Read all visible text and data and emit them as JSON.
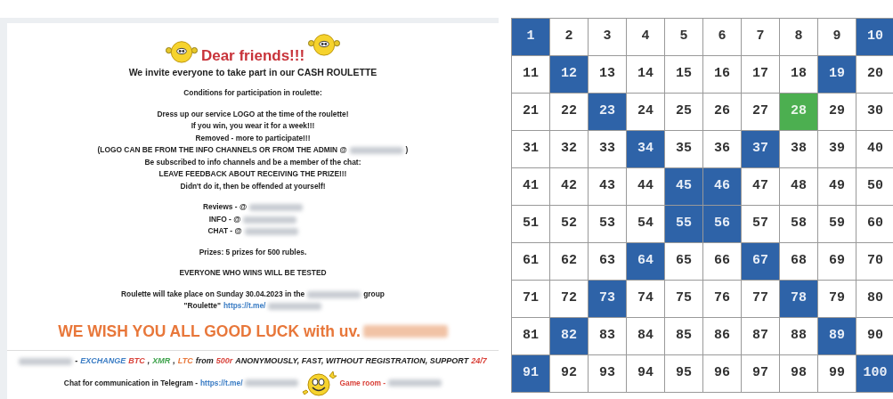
{
  "notice": {
    "title": "Dear friends!!!",
    "blocks": [
      [
        {
          "kind": "heading",
          "segments": [
            {
              "kind": "text",
              "text": "We invite everyone to take part in our CASH ROULETTE"
            }
          ]
        }
      ],
      [
        {
          "kind": "line",
          "segments": [
            {
              "kind": "text",
              "text": "Conditions for participation in roulette:"
            }
          ]
        }
      ],
      [
        {
          "kind": "line",
          "segments": [
            {
              "kind": "text",
              "text": "Dress up our service LOGO at the time of the roulette!"
            }
          ]
        },
        {
          "kind": "line",
          "segments": [
            {
              "kind": "text",
              "text": "If you win, you wear it for a week!!!"
            }
          ]
        },
        {
          "kind": "line",
          "segments": [
            {
              "kind": "text",
              "text": "Removed - more to participate!!!"
            }
          ]
        },
        {
          "kind": "line",
          "segments": [
            {
              "kind": "text",
              "text": "(LOGO CAN BE FROM THE INFO CHANNELS OR FROM THE ADMIN @"
            },
            {
              "kind": "redacted"
            },
            {
              "kind": "text",
              "text": ")"
            }
          ]
        },
        {
          "kind": "line",
          "segments": [
            {
              "kind": "text",
              "text": "Be subscribed to info channels and be a member of the chat:"
            }
          ]
        },
        {
          "kind": "line",
          "segments": [
            {
              "kind": "text",
              "text": "LEAVE FEEDBACK ABOUT RECEIVING THE PRIZE!!!"
            }
          ]
        },
        {
          "kind": "line",
          "segments": [
            {
              "kind": "text",
              "text": "Didn't do it, then be offended at yourself!"
            }
          ]
        }
      ],
      [
        {
          "kind": "line",
          "segments": [
            {
              "kind": "text",
              "text": "Reviews - @"
            },
            {
              "kind": "redacted"
            }
          ]
        },
        {
          "kind": "line",
          "segments": [
            {
              "kind": "text",
              "text": "INFO - @"
            },
            {
              "kind": "redacted"
            }
          ]
        },
        {
          "kind": "line",
          "segments": [
            {
              "kind": "text",
              "text": "CHAT - @"
            },
            {
              "kind": "redacted"
            }
          ]
        }
      ],
      [
        {
          "kind": "line",
          "segments": [
            {
              "kind": "text",
              "text": "Prizes: 5 prizes for 500 rubles."
            }
          ]
        }
      ],
      [
        {
          "kind": "line",
          "segments": [
            {
              "kind": "text",
              "text": "EVERYONE WHO WINS WILL BE TESTED"
            }
          ]
        }
      ],
      [
        {
          "kind": "line",
          "segments": [
            {
              "kind": "text",
              "text": "Roulette will take place on Sunday 30.04.2023 in the"
            },
            {
              "kind": "redacted"
            },
            {
              "kind": "text",
              "text": "group"
            }
          ]
        },
        {
          "kind": "line",
          "segments": [
            {
              "kind": "text",
              "text": "\"Roulette\""
            },
            {
              "kind": "link",
              "text": "https://t.me/"
            },
            {
              "kind": "redacted"
            }
          ]
        }
      ],
      [
        {
          "kind": "wish",
          "segments": [
            {
              "kind": "text",
              "text": "WE WISH YOU ALL GOOD LUCK with uv."
            },
            {
              "kind": "redacted"
            }
          ]
        }
      ]
    ],
    "exchange": [
      {
        "kind": "redacted"
      },
      {
        "kind": "text",
        "text": "-"
      },
      {
        "kind": "text",
        "text": "EXCHANGE",
        "color": "#3a7cc4"
      },
      {
        "kind": "text",
        "text": "BTC",
        "color": "#d9423a"
      },
      {
        "kind": "text",
        "text": ","
      },
      {
        "kind": "text",
        "text": "XMR",
        "color": "#3fa34d"
      },
      {
        "kind": "text",
        "text": ","
      },
      {
        "kind": "text",
        "text": "LTC",
        "color": "#e8773a"
      },
      {
        "kind": "text",
        "text": "from",
        "color": "#222222"
      },
      {
        "kind": "text",
        "text": "500r",
        "color": "#d9423a"
      },
      {
        "kind": "text",
        "text": "ANONYMOUSLY, FAST, WITHOUT REGISTRATION, SUPPORT",
        "color": "#222222"
      },
      {
        "kind": "text",
        "text": "24/7",
        "color": "#d9423a"
      }
    ],
    "footer": [
      {
        "kind": "text",
        "text": "Chat for communication in Telegram -"
      },
      {
        "kind": "link",
        "text": "https://t.me/"
      },
      {
        "kind": "redacted"
      },
      {
        "kind": "smiley"
      },
      {
        "kind": "alert",
        "text": "Game room -"
      },
      {
        "kind": "redacted"
      }
    ]
  },
  "board": {
    "cells": [
      {
        "number": "1",
        "kind": "marked"
      },
      {
        "number": "2",
        "kind": "plain"
      },
      {
        "number": "3",
        "kind": "plain"
      },
      {
        "number": "4",
        "kind": "plain"
      },
      {
        "number": "5",
        "kind": "plain"
      },
      {
        "number": "6",
        "kind": "plain"
      },
      {
        "number": "7",
        "kind": "plain"
      },
      {
        "number": "8",
        "kind": "plain"
      },
      {
        "number": "9",
        "kind": "plain"
      },
      {
        "number": "10",
        "kind": "marked"
      },
      {
        "number": "11",
        "kind": "plain"
      },
      {
        "number": "12",
        "kind": "marked"
      },
      {
        "number": "13",
        "kind": "plain"
      },
      {
        "number": "14",
        "kind": "plain"
      },
      {
        "number": "15",
        "kind": "plain"
      },
      {
        "number": "16",
        "kind": "plain"
      },
      {
        "number": "17",
        "kind": "plain"
      },
      {
        "number": "18",
        "kind": "plain"
      },
      {
        "number": "19",
        "kind": "marked"
      },
      {
        "number": "20",
        "kind": "plain"
      },
      {
        "number": "21",
        "kind": "plain"
      },
      {
        "number": "22",
        "kind": "plain"
      },
      {
        "number": "23",
        "kind": "marked"
      },
      {
        "number": "24",
        "kind": "plain"
      },
      {
        "number": "25",
        "kind": "plain"
      },
      {
        "number": "26",
        "kind": "plain"
      },
      {
        "number": "27",
        "kind": "plain"
      },
      {
        "number": "28",
        "kind": "winner"
      },
      {
        "number": "29",
        "kind": "plain"
      },
      {
        "number": "30",
        "kind": "plain"
      },
      {
        "number": "31",
        "kind": "plain"
      },
      {
        "number": "32",
        "kind": "plain"
      },
      {
        "number": "33",
        "kind": "plain"
      },
      {
        "number": "34",
        "kind": "marked"
      },
      {
        "number": "35",
        "kind": "plain"
      },
      {
        "number": "36",
        "kind": "plain"
      },
      {
        "number": "37",
        "kind": "marked"
      },
      {
        "number": "38",
        "kind": "plain"
      },
      {
        "number": "39",
        "kind": "plain"
      },
      {
        "number": "40",
        "kind": "plain"
      },
      {
        "number": "41",
        "kind": "plain"
      },
      {
        "number": "42",
        "kind": "plain"
      },
      {
        "number": "43",
        "kind": "plain"
      },
      {
        "number": "44",
        "kind": "plain"
      },
      {
        "number": "45",
        "kind": "marked"
      },
      {
        "number": "46",
        "kind": "marked"
      },
      {
        "number": "47",
        "kind": "plain"
      },
      {
        "number": "48",
        "kind": "plain"
      },
      {
        "number": "49",
        "kind": "plain"
      },
      {
        "number": "50",
        "kind": "plain"
      },
      {
        "number": "51",
        "kind": "plain"
      },
      {
        "number": "52",
        "kind": "plain"
      },
      {
        "number": "53",
        "kind": "plain"
      },
      {
        "number": "54",
        "kind": "plain"
      },
      {
        "number": "55",
        "kind": "marked"
      },
      {
        "number": "56",
        "kind": "marked"
      },
      {
        "number": "57",
        "kind": "plain"
      },
      {
        "number": "58",
        "kind": "plain"
      },
      {
        "number": "59",
        "kind": "plain"
      },
      {
        "number": "60",
        "kind": "plain"
      },
      {
        "number": "61",
        "kind": "plain"
      },
      {
        "number": "62",
        "kind": "plain"
      },
      {
        "number": "63",
        "kind": "plain"
      },
      {
        "number": "64",
        "kind": "marked"
      },
      {
        "number": "65",
        "kind": "plain"
      },
      {
        "number": "66",
        "kind": "plain"
      },
      {
        "number": "67",
        "kind": "marked"
      },
      {
        "number": "68",
        "kind": "plain"
      },
      {
        "number": "69",
        "kind": "plain"
      },
      {
        "number": "70",
        "kind": "plain"
      },
      {
        "number": "71",
        "kind": "plain"
      },
      {
        "number": "72",
        "kind": "plain"
      },
      {
        "number": "73",
        "kind": "marked"
      },
      {
        "number": "74",
        "kind": "plain"
      },
      {
        "number": "75",
        "kind": "plain"
      },
      {
        "number": "76",
        "kind": "plain"
      },
      {
        "number": "77",
        "kind": "plain"
      },
      {
        "number": "78",
        "kind": "marked"
      },
      {
        "number": "79",
        "kind": "plain"
      },
      {
        "number": "80",
        "kind": "plain"
      },
      {
        "number": "81",
        "kind": "plain"
      },
      {
        "number": "82",
        "kind": "marked"
      },
      {
        "number": "83",
        "kind": "plain"
      },
      {
        "number": "84",
        "kind": "plain"
      },
      {
        "number": "85",
        "kind": "plain"
      },
      {
        "number": "86",
        "kind": "plain"
      },
      {
        "number": "87",
        "kind": "plain"
      },
      {
        "number": "88",
        "kind": "plain"
      },
      {
        "number": "89",
        "kind": "marked"
      },
      {
        "number": "90",
        "kind": "plain"
      },
      {
        "number": "91",
        "kind": "marked"
      },
      {
        "number": "92",
        "kind": "plain"
      },
      {
        "number": "93",
        "kind": "plain"
      },
      {
        "number": "94",
        "kind": "plain"
      },
      {
        "number": "95",
        "kind": "plain"
      },
      {
        "number": "96",
        "kind": "plain"
      },
      {
        "number": "97",
        "kind": "plain"
      },
      {
        "number": "98",
        "kind": "plain"
      },
      {
        "number": "99",
        "kind": "plain"
      },
      {
        "number": "100",
        "kind": "marked"
      }
    ]
  }
}
